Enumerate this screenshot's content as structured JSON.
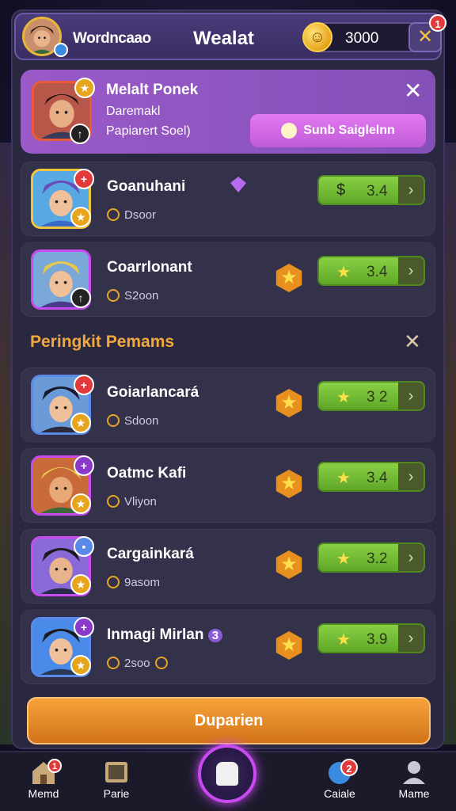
{
  "header": {
    "username": "Wordncaao",
    "title": "Wealat",
    "coins": "3000",
    "notification_count": "1"
  },
  "featured": {
    "name": "Melalt Ponek",
    "sub1": "Daremakl",
    "sub2": "Papiarert Soel)",
    "button_label": "Sunb Saiglelnn"
  },
  "top_rows": [
    {
      "name": "Goanuhani",
      "sub": "Dsoor",
      "price_icon": "$",
      "price": "3.4"
    },
    {
      "name": "Coarrlonant",
      "sub": "S2oon",
      "price_icon": "★",
      "price": "3.4"
    }
  ],
  "section": {
    "title": "Peringkit Pemams"
  },
  "ranking_rows": [
    {
      "name": "Goiarlancará",
      "sub": "Sdoon",
      "price": "3 2"
    },
    {
      "name": "Oatmc Kafi",
      "sub": "Vliyon",
      "price": "3.4"
    },
    {
      "name": "Cargainkará",
      "sub": "9asom",
      "price": "3.2"
    },
    {
      "name": "Inmagi Mirlan",
      "name_badge": "3",
      "sub": "2soo",
      "price": "3.9"
    }
  ],
  "cta_label": "Duparien",
  "nav": {
    "items": [
      {
        "label": "Memd",
        "badge": "1"
      },
      {
        "label": "Parie",
        "badge": ""
      },
      {
        "label": "Caiale",
        "badge": "2"
      },
      {
        "label": "Mame",
        "badge": ""
      }
    ]
  },
  "colors": {
    "accent_purple": "#9a5ac8",
    "price_green": "#6fb832",
    "section_orange": "#f2a83a",
    "cta_orange": "#e68a2a"
  }
}
